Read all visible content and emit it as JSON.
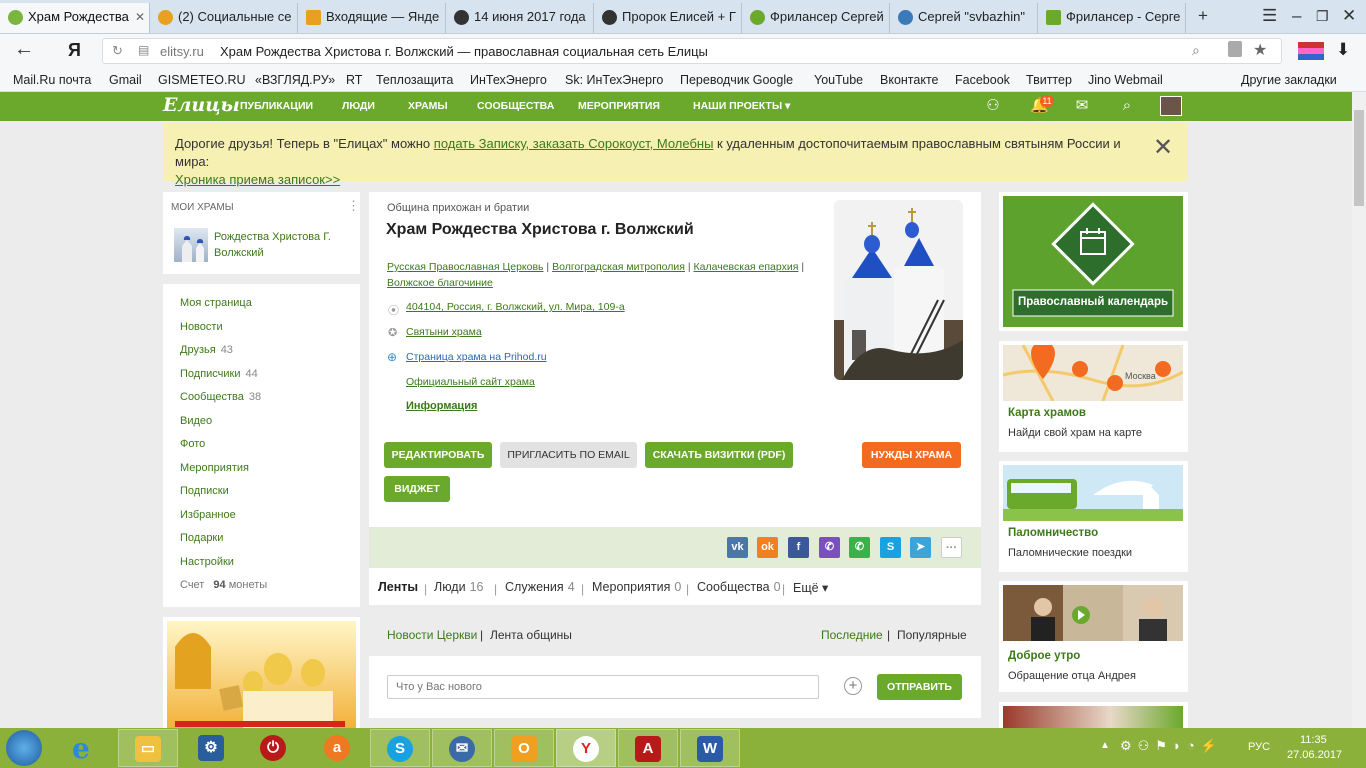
{
  "browser": {
    "tabs": [
      {
        "label": "Храм Рождества",
        "color": "#7ab53e"
      },
      {
        "label": "(2) Социальные се",
        "color": "#e8a020"
      },
      {
        "label": "Входящие — Янде",
        "color": "#e8a020"
      },
      {
        "label": "14 июня 2017 года",
        "color": "#333333"
      },
      {
        "label": "Пророк Елисей + Г",
        "color": "#333333"
      },
      {
        "label": "Фрилансер Сергей",
        "color": "#6aa92b"
      },
      {
        "label": "Сергей \"svbazhin\"",
        "color": "#3a7ab8"
      },
      {
        "label": "Фрилансер - Серге",
        "color": "#6aa92b"
      }
    ],
    "new_tab": "+",
    "yandex_logo": "Я",
    "url_host": "elitsy.ru",
    "page_title": "Храм Рождества Христова г. Волжский — православная социальная сеть Елицы",
    "bookmarks": [
      "Mail.Ru почта",
      "Gmail",
      "GISMETEO.RU",
      "«ВЗГЛЯД.РУ»",
      "RT",
      "Теплозащита",
      "ИнТехЭнерго",
      "Sk: ИнТехЭнерго",
      "Переводчик Google",
      "YouTube",
      "Вконтакте",
      "Facebook",
      "Твиттер",
      "Jino Webmail"
    ],
    "other_bookmarks": "Другие закладки"
  },
  "site": {
    "logo": "Елицы",
    "nav": [
      "ПУБЛИКАЦИИ",
      "ЛЮДИ",
      "ХРАМЫ",
      "СООБЩЕСТВА",
      "МЕРОПРИЯТИЯ",
      "НАШИ ПРОЕКТЫ ▾"
    ],
    "notifications": "11",
    "accent": "#6aa92b"
  },
  "notice": {
    "pre": "Дорогие друзья! Теперь в \"Елицах\" можно ",
    "link1": "подать Записку, заказать Сорокоуст, Молебны",
    "mid": " к удаленным достопочитаемым православным святыням России и мира:",
    "link2": "Хроника приема записок>>"
  },
  "left": {
    "my_temples_title": "МОИ ХРАМЫ",
    "my_temple": "Рождества Христова Г. Волжский",
    "menu": [
      {
        "label": "Моя страница",
        "count": ""
      },
      {
        "label": "Новости",
        "count": ""
      },
      {
        "label": "Друзья",
        "count": "43"
      },
      {
        "label": "Подписчики",
        "count": "44"
      },
      {
        "label": "Сообщества",
        "count": "38"
      },
      {
        "label": "Видео",
        "count": ""
      },
      {
        "label": "Фото",
        "count": ""
      },
      {
        "label": "Мероприятия",
        "count": ""
      },
      {
        "label": "Подписки",
        "count": ""
      },
      {
        "label": "Избранное",
        "count": ""
      },
      {
        "label": "Подарки",
        "count": ""
      },
      {
        "label": "Настройки",
        "count": ""
      }
    ],
    "account_label": "Счет",
    "account_value": "94",
    "account_unit": "монеты"
  },
  "main": {
    "subtitle": "Община прихожан и братии",
    "title": "Храм Рождества Христова г. Волжский",
    "breadcrumbs": [
      "Русская Православная Церковь",
      "Волгоградская митрополия",
      "Калачевская епархия",
      "Волжское благочиние"
    ],
    "address": "404104, Россия, г. Волжский, ул. Мира, 109-а",
    "shrines": "Святыни храма",
    "prihod": "Страница храма на Prihod.ru",
    "official": "Официальный сайт храма",
    "info": "Информация",
    "buttons": {
      "edit": "РЕДАКТИРОВАТЬ",
      "invite": "ПРИГЛАСИТЬ ПО EMAIL",
      "download": "СКАЧАТЬ ВИЗИТКИ (PDF)",
      "needs": "НУЖДЫ ХРАМА",
      "widget": "ВИДЖЕТ"
    },
    "tabs": [
      {
        "label": "Ленты",
        "count": ""
      },
      {
        "label": "Люди",
        "count": "16"
      },
      {
        "label": "Служения",
        "count": "4"
      },
      {
        "label": "Мероприятия",
        "count": "0"
      },
      {
        "label": "Сообщества",
        "count": "0"
      },
      {
        "label": "Ещё ▾",
        "count": ""
      }
    ],
    "feed_left": "Новости Церкви",
    "feed_left2": "Лента общины",
    "feed_right": "Последние",
    "feed_right2": "Популярные",
    "post_placeholder": "Что у Вас нового",
    "send": "ОТПРАВИТЬ"
  },
  "right": [
    {
      "title": "",
      "sub": "",
      "banner": "Православный календарь"
    },
    {
      "title": "Карта храмов",
      "sub": "Найди свой храм на карте",
      "banner": "Москва"
    },
    {
      "title": "Паломничество",
      "sub": "Паломнические поездки",
      "banner": ""
    },
    {
      "title": "Доброе утро",
      "sub": "Обращение отца Андрея",
      "banner": ""
    }
  ],
  "taskbar": {
    "lang": "РУС",
    "time": "11:35",
    "date": "27.06.2017"
  }
}
